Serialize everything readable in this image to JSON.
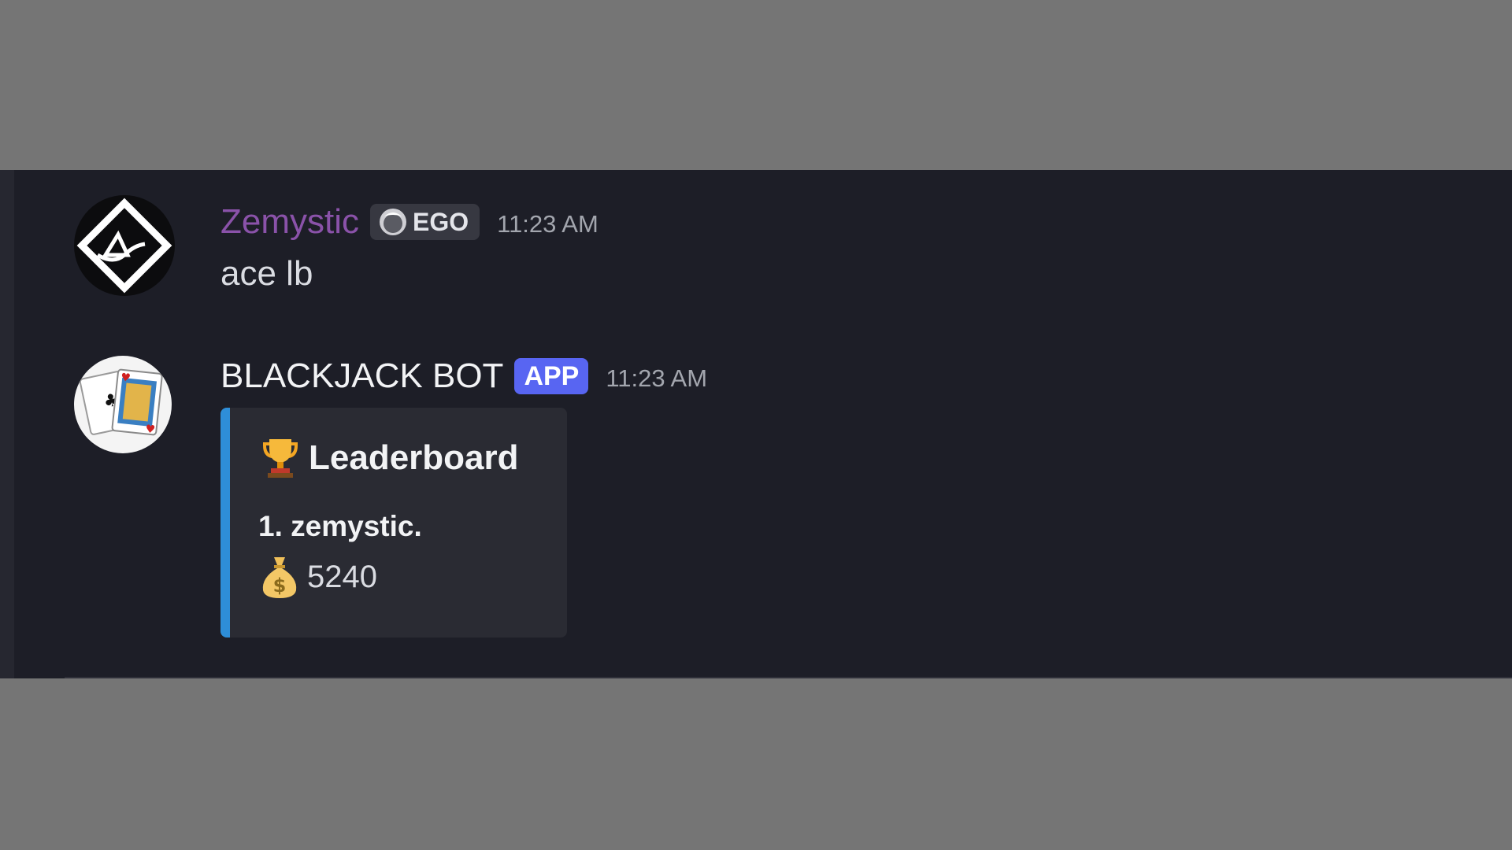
{
  "messages": [
    {
      "author": "Zemystic",
      "role_tag": "EGO",
      "role_icon": "ego-role-icon",
      "timestamp": "11:23 AM",
      "text": "ace lb",
      "author_color": "#8a52a9"
    },
    {
      "author": "BLACKJACK BOT",
      "badge": "APP",
      "timestamp": "11:23 AM",
      "embed": {
        "accent_color": "#2e8ed8",
        "title_icon": "trophy-icon",
        "title": "Leaderboard",
        "entries": [
          {
            "rank_line": "1. zemystic.",
            "amount_icon": "moneybag-icon",
            "amount": "5240"
          }
        ]
      }
    }
  ],
  "colors": {
    "background_outer": "#757575",
    "chat_background": "#1d1e27",
    "app_badge": "#5865f2"
  }
}
